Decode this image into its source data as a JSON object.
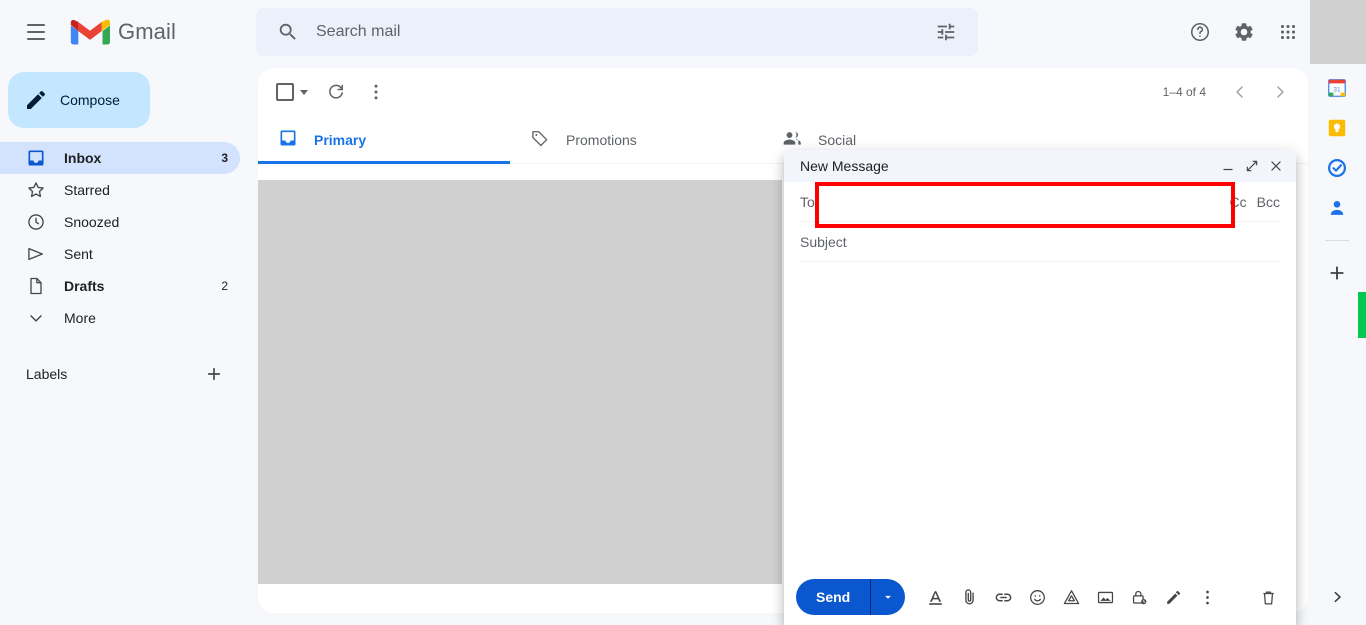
{
  "app": {
    "brand_name": "Gmail",
    "menu_icon": "hamburger-icon"
  },
  "search": {
    "placeholder": "Search mail",
    "value": "",
    "search_icon": "search-icon",
    "options_icon": "tune-options-icon"
  },
  "topbar": {
    "support_icon": "help-question-icon",
    "settings_icon": "gear-icon",
    "apps_icon": "apps-grid-icon"
  },
  "sidebar": {
    "compose_label": "Compose",
    "compose_icon": "pencil-icon",
    "items": [
      {
        "label": "Inbox",
        "count": "3",
        "icon": "inbox-icon",
        "active": true
      },
      {
        "label": "Starred",
        "count": "",
        "icon": "star-icon",
        "active": false
      },
      {
        "label": "Snoozed",
        "count": "",
        "icon": "clock-icon",
        "active": false
      },
      {
        "label": "Sent",
        "count": "",
        "icon": "send-icon",
        "active": false
      },
      {
        "label": "Drafts",
        "count": "2",
        "icon": "draft-icon",
        "active": false
      },
      {
        "label": "More",
        "count": "",
        "icon": "chevron-down-icon",
        "active": false
      }
    ],
    "labels_title": "Labels",
    "labels_add_icon": "plus-icon"
  },
  "list_toolbar": {
    "select_all_icon": "checkbox-icon",
    "select_dropdown_icon": "caret-down-icon",
    "refresh_icon": "refresh-icon",
    "more_icon": "more-vertical-icon",
    "pagination": "1–4 of 4",
    "prev_icon": "chevron-left-icon",
    "next_icon": "chevron-right-icon"
  },
  "tabs": [
    {
      "label": "Primary",
      "icon": "inbox-tab-icon",
      "active": true
    },
    {
      "label": "Promotions",
      "icon": "tag-icon",
      "active": false
    },
    {
      "label": "Social",
      "icon": "people-icon",
      "active": false
    }
  ],
  "compose": {
    "title": "New Message",
    "minimize_icon": "minimize-icon",
    "maximize_icon": "expand-icon",
    "close_icon": "close-icon",
    "to_label": "To",
    "to_value": "",
    "cc_label": "Cc",
    "bcc_label": "Bcc",
    "subject_placeholder": "Subject",
    "subject_value": "",
    "body_value": "",
    "send_label": "Send",
    "send_options_icon": "caret-down-icon",
    "toolbar_icons": [
      "format-text-icon",
      "attach-file-icon",
      "insert-link-icon",
      "insert-emoji-icon",
      "insert-drive-icon",
      "insert-photo-icon",
      "confidential-mode-icon",
      "insert-signature-icon",
      "more-options-icon"
    ],
    "discard_icon": "trash-icon"
  },
  "right_rail": {
    "items": [
      "calendar-icon",
      "keep-icon",
      "tasks-icon",
      "contacts-icon"
    ],
    "add_icon": "plus-icon",
    "expand_icon": "chevron-right-icon"
  },
  "colors": {
    "accent_blue": "#1a73e8",
    "send_blue": "#0b57d0",
    "compose_chip": "#c2e7ff",
    "active_nav": "#d3e3fd",
    "annotation_red": "#ff0000",
    "scroll_green": "#00c853",
    "page_bg": "#f6f8fc"
  }
}
